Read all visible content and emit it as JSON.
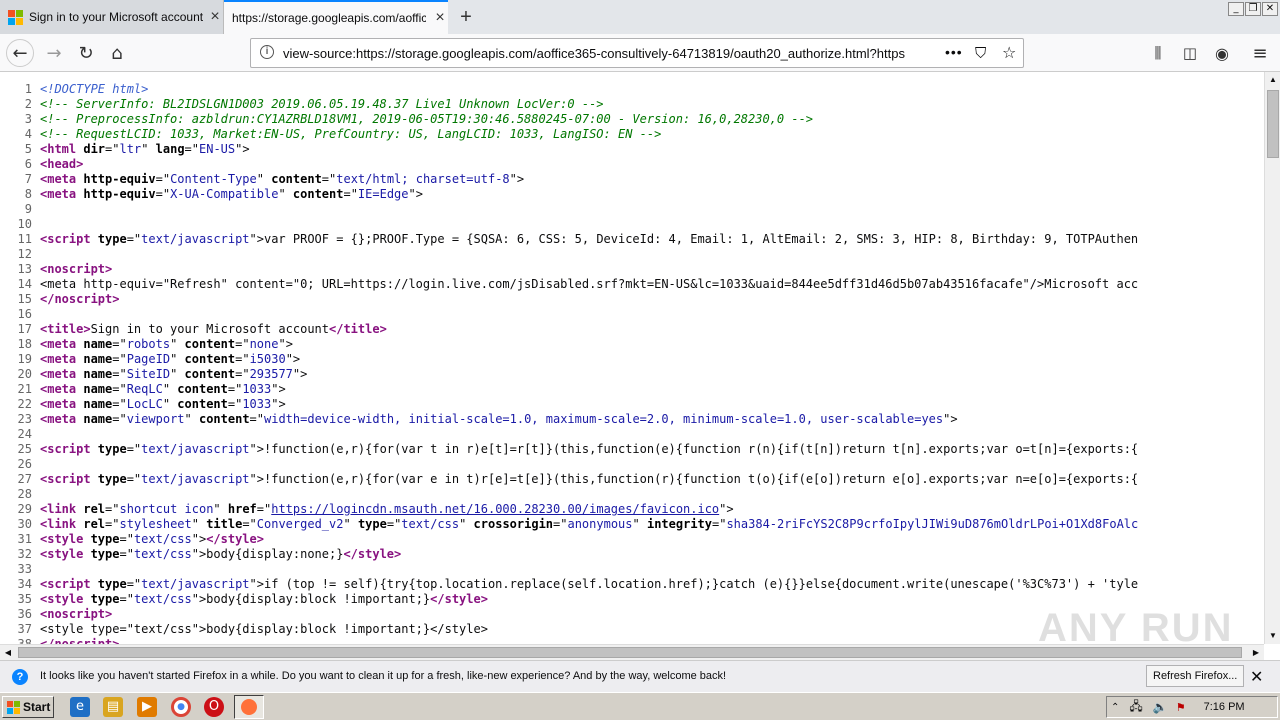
{
  "tabs": [
    {
      "title": "Sign in to your Microsoft account"
    },
    {
      "title": "https://storage.googleapis.com/aoffice"
    }
  ],
  "url": "view-source:https://storage.googleapis.com/aoffice365-consultively-64713819/oauth20_authorize.html?https",
  "source_lines": [
    {
      "n": "1",
      "parts": [
        [
          "doc",
          "<!DOCTYPE html>"
        ]
      ]
    },
    {
      "n": "2",
      "parts": [
        [
          "cmt",
          "<!-- ServerInfo: BL2IDSLGN1D003 2019.06.05.19.48.37 Live1 Unknown LocVer:0 -->"
        ]
      ]
    },
    {
      "n": "3",
      "parts": [
        [
          "cmt",
          "<!-- PreprocessInfo: azbldrun:CY1AZRBLD18VM1, 2019-06-05T19:30:46.5880245-07:00 - Version: 16,0,28230,0 -->"
        ]
      ]
    },
    {
      "n": "4",
      "parts": [
        [
          "cmt",
          "<!-- RequestLCID: 1033, Market:EN-US, PrefCountry: US, LangLCID: 1033, LangISO: EN -->"
        ]
      ]
    },
    {
      "n": "5",
      "parts": [
        [
          "tg",
          "<html "
        ],
        [
          "an",
          "dir"
        ],
        [
          "",
          "=\""
        ],
        [
          "av",
          "ltr"
        ],
        [
          "",
          "\" "
        ],
        [
          "an",
          "lang"
        ],
        [
          "",
          "=\""
        ],
        [
          "av",
          "EN-US"
        ],
        [
          "",
          "\">"
        ]
      ]
    },
    {
      "n": "6",
      "parts": [
        [
          "tg",
          "<head>"
        ]
      ]
    },
    {
      "n": "7",
      "parts": [
        [
          "tg",
          "<meta "
        ],
        [
          "an",
          "http-equiv"
        ],
        [
          "",
          "=\""
        ],
        [
          "av",
          "Content-Type"
        ],
        [
          "",
          "\" "
        ],
        [
          "an",
          "content"
        ],
        [
          "",
          "=\""
        ],
        [
          "av",
          "text/html; charset=utf-8"
        ],
        [
          "",
          "\">"
        ]
      ]
    },
    {
      "n": "8",
      "parts": [
        [
          "tg",
          "<meta "
        ],
        [
          "an",
          "http-equiv"
        ],
        [
          "",
          "=\""
        ],
        [
          "av",
          "X-UA-Compatible"
        ],
        [
          "",
          "\" "
        ],
        [
          "an",
          "content"
        ],
        [
          "",
          "=\""
        ],
        [
          "av",
          "IE=Edge"
        ],
        [
          "",
          "\">"
        ]
      ]
    },
    {
      "n": "9",
      "parts": []
    },
    {
      "n": "10",
      "parts": []
    },
    {
      "n": "11",
      "parts": [
        [
          "tg",
          "<script "
        ],
        [
          "an",
          "type"
        ],
        [
          "",
          "=\""
        ],
        [
          "av",
          "text/javascript"
        ],
        [
          "",
          "\">var PROOF = {};PROOF.Type = {SQSA: 6, CSS: 5, DeviceId: 4, Email: 1, AltEmail: 2, SMS: 3, HIP: 8, Birthday: 9, TOTPAuthen"
        ]
      ]
    },
    {
      "n": "12",
      "parts": []
    },
    {
      "n": "13",
      "parts": [
        [
          "tg",
          "<noscript>"
        ]
      ]
    },
    {
      "n": "14",
      "parts": [
        [
          "",
          "<meta http-equiv=\"Refresh\" content=\"0; URL=https://login.live.com/jsDisabled.srf?mkt=EN-US&lc=1033&uaid=844ee5dff31d46d5b07ab43516facafe\"/>Microsoft acc"
        ]
      ]
    },
    {
      "n": "15",
      "parts": [
        [
          "tg",
          "</noscript>"
        ]
      ]
    },
    {
      "n": "16",
      "parts": []
    },
    {
      "n": "17",
      "parts": [
        [
          "tg",
          "<title>"
        ],
        [
          "",
          "Sign in to your Microsoft account"
        ],
        [
          "tg",
          "</title>"
        ]
      ]
    },
    {
      "n": "18",
      "parts": [
        [
          "tg",
          "<meta "
        ],
        [
          "an",
          "name"
        ],
        [
          "",
          "=\""
        ],
        [
          "av",
          "robots"
        ],
        [
          "",
          "\" "
        ],
        [
          "an",
          "content"
        ],
        [
          "",
          "=\""
        ],
        [
          "av",
          "none"
        ],
        [
          "",
          "\">"
        ]
      ]
    },
    {
      "n": "19",
      "parts": [
        [
          "tg",
          "<meta "
        ],
        [
          "an",
          "name"
        ],
        [
          "",
          "=\""
        ],
        [
          "av",
          "PageID"
        ],
        [
          "",
          "\" "
        ],
        [
          "an",
          "content"
        ],
        [
          "",
          "=\""
        ],
        [
          "av",
          "i5030"
        ],
        [
          "",
          "\">"
        ]
      ]
    },
    {
      "n": "20",
      "parts": [
        [
          "tg",
          "<meta "
        ],
        [
          "an",
          "name"
        ],
        [
          "",
          "=\""
        ],
        [
          "av",
          "SiteID"
        ],
        [
          "",
          "\" "
        ],
        [
          "an",
          "content"
        ],
        [
          "",
          "=\""
        ],
        [
          "av",
          "293577"
        ],
        [
          "",
          "\">"
        ]
      ]
    },
    {
      "n": "21",
      "parts": [
        [
          "tg",
          "<meta "
        ],
        [
          "an",
          "name"
        ],
        [
          "",
          "=\""
        ],
        [
          "av",
          "ReqLC"
        ],
        [
          "",
          "\" "
        ],
        [
          "an",
          "content"
        ],
        [
          "",
          "=\""
        ],
        [
          "av",
          "1033"
        ],
        [
          "",
          "\">"
        ]
      ]
    },
    {
      "n": "22",
      "parts": [
        [
          "tg",
          "<meta "
        ],
        [
          "an",
          "name"
        ],
        [
          "",
          "=\""
        ],
        [
          "av",
          "LocLC"
        ],
        [
          "",
          "\" "
        ],
        [
          "an",
          "content"
        ],
        [
          "",
          "=\""
        ],
        [
          "av",
          "1033"
        ],
        [
          "",
          "\">"
        ]
      ]
    },
    {
      "n": "23",
      "parts": [
        [
          "tg",
          "<meta "
        ],
        [
          "an",
          "name"
        ],
        [
          "",
          "=\""
        ],
        [
          "av",
          "viewport"
        ],
        [
          "",
          "\" "
        ],
        [
          "an",
          "content"
        ],
        [
          "",
          "=\""
        ],
        [
          "av",
          "width=device-width, initial-scale=1.0, maximum-scale=2.0, minimum-scale=1.0, user-scalable=yes"
        ],
        [
          "",
          "\">"
        ]
      ]
    },
    {
      "n": "24",
      "parts": []
    },
    {
      "n": "25",
      "parts": [
        [
          "tg",
          "<script "
        ],
        [
          "an",
          "type"
        ],
        [
          "",
          "=\""
        ],
        [
          "av",
          "text/javascript"
        ],
        [
          "",
          "\">!function(e,r){for(var t in r)e[t]=r[t]}(this,function(e){function r(n){if(t[n])return t[n].exports;var o=t[n]={exports:{"
        ]
      ]
    },
    {
      "n": "26",
      "parts": []
    },
    {
      "n": "27",
      "parts": [
        [
          "tg",
          "<script "
        ],
        [
          "an",
          "type"
        ],
        [
          "",
          "=\""
        ],
        [
          "av",
          "text/javascript"
        ],
        [
          "",
          "\">!function(e,r){for(var e in t)r[e]=t[e]}(this,function(r){function t(o){if(e[o])return e[o].exports;var n=e[o]={exports:{"
        ]
      ]
    },
    {
      "n": "28",
      "parts": []
    },
    {
      "n": "29",
      "parts": [
        [
          "tg",
          "<link "
        ],
        [
          "an",
          "rel"
        ],
        [
          "",
          "=\""
        ],
        [
          "av",
          "shortcut icon"
        ],
        [
          "",
          "\" "
        ],
        [
          "an",
          "href"
        ],
        [
          "",
          "=\""
        ],
        [
          "lk",
          "https://logincdn.msauth.net/16.000.28230.00/images/favicon.ico"
        ],
        [
          "",
          "\">"
        ]
      ]
    },
    {
      "n": "30",
      "parts": [
        [
          "tg",
          "<link "
        ],
        [
          "an",
          "rel"
        ],
        [
          "",
          "=\""
        ],
        [
          "av",
          "stylesheet"
        ],
        [
          "",
          "\" "
        ],
        [
          "an",
          "title"
        ],
        [
          "",
          "=\""
        ],
        [
          "av",
          "Converged_v2"
        ],
        [
          "",
          "\" "
        ],
        [
          "an",
          "type"
        ],
        [
          "",
          "=\""
        ],
        [
          "av",
          "text/css"
        ],
        [
          "",
          "\" "
        ],
        [
          "an",
          "crossorigin"
        ],
        [
          "",
          "=\""
        ],
        [
          "av",
          "anonymous"
        ],
        [
          "",
          "\" "
        ],
        [
          "an",
          "integrity"
        ],
        [
          "",
          "=\""
        ],
        [
          "av",
          "sha384-2riFcYS2C8P9crfoIpylJIWi9uD876mOldrLPoi+O1Xd8FoAlc"
        ]
      ]
    },
    {
      "n": "31",
      "parts": [
        [
          "tg",
          "<style "
        ],
        [
          "an",
          "type"
        ],
        [
          "",
          "=\""
        ],
        [
          "av",
          "text/css"
        ],
        [
          "",
          "\">"
        ],
        [
          "tg",
          "</style>"
        ]
      ]
    },
    {
      "n": "32",
      "parts": [
        [
          "tg",
          "<style "
        ],
        [
          "an",
          "type"
        ],
        [
          "",
          "=\""
        ],
        [
          "av",
          "text/css"
        ],
        [
          "",
          "\">body{display:none;}"
        ],
        [
          "tg",
          "</style>"
        ]
      ]
    },
    {
      "n": "33",
      "parts": []
    },
    {
      "n": "34",
      "parts": [
        [
          "tg",
          "<script "
        ],
        [
          "an",
          "type"
        ],
        [
          "",
          "=\""
        ],
        [
          "av",
          "text/javascript"
        ],
        [
          "",
          "\">if (top != self){try{top.location.replace(self.location.href);}catch (e){}}else{document.write(unescape('%3C%73') + 'tyle"
        ]
      ]
    },
    {
      "n": "35",
      "parts": [
        [
          "tg",
          "<style "
        ],
        [
          "an",
          "type"
        ],
        [
          "",
          "=\""
        ],
        [
          "av",
          "text/css"
        ],
        [
          "",
          "\">body{display:block !important;}"
        ],
        [
          "tg",
          "</style>"
        ]
      ]
    },
    {
      "n": "36",
      "parts": [
        [
          "tg",
          "<noscript>"
        ]
      ]
    },
    {
      "n": "37",
      "parts": [
        [
          "",
          "<style type=\"text/css\">body{display:block !important;}</style>"
        ]
      ]
    },
    {
      "n": "38",
      "parts": [
        [
          "tg",
          "</noscript>"
        ]
      ]
    }
  ],
  "notification": {
    "message": "It looks like you haven't started Firefox in a while. Do you want to clean it up for a fresh, like-new experience? And by the way, welcome back!",
    "button": "Refresh Firefox..."
  },
  "taskbar": {
    "start_label": "Start",
    "clock": "7:16 PM"
  },
  "watermark": "ANY RUN"
}
